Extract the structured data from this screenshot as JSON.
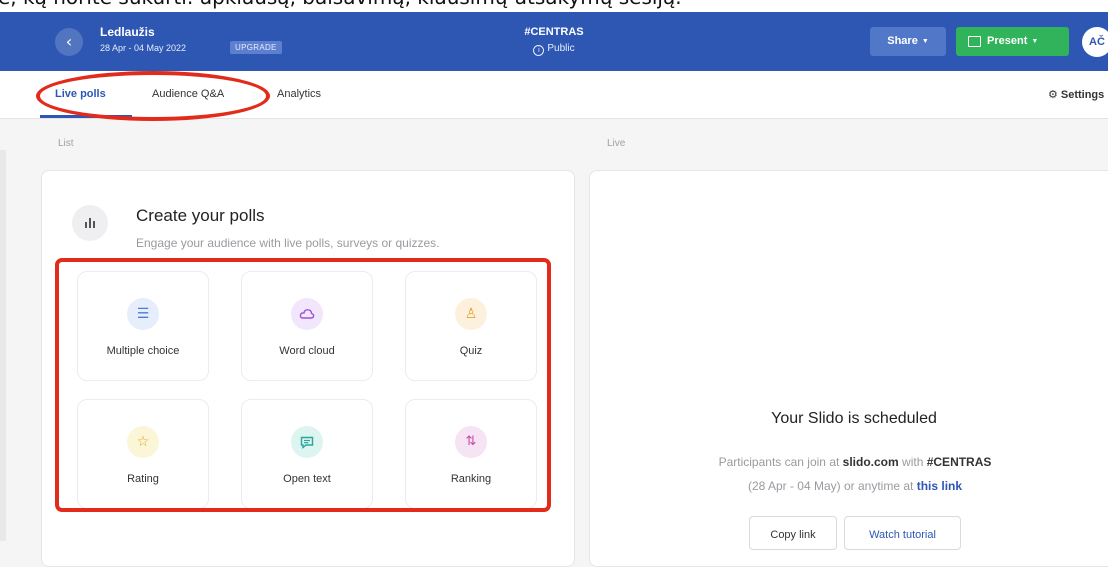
{
  "caption": "e, ką norite sukurti: apklausą, balsavimą, klausimų-atsakymų sesiją.",
  "header": {
    "event_title": "Ledlaužis",
    "event_dates": "28 Apr - 04 May 2022",
    "upgrade_label": "UPGRADE",
    "event_code": "#CENTRAS",
    "visibility": "Public",
    "share_label": "Share",
    "present_label": "Present",
    "avatar_initials": "AČ"
  },
  "tabs": {
    "live_polls": "Live polls",
    "audience_qa": "Audience Q&A",
    "analytics": "Analytics",
    "settings": "Settings"
  },
  "sections": {
    "list": "List",
    "live": "Live"
  },
  "create": {
    "title": "Create your polls",
    "subtitle": "Engage your audience with live polls, surveys or quizzes.",
    "poll_types": [
      {
        "label": "Multiple choice",
        "icon": "list-icon",
        "color": "#e6eefc"
      },
      {
        "label": "Word cloud",
        "icon": "cloud-icon",
        "color": "#f1e6fb"
      },
      {
        "label": "Quiz",
        "icon": "trophy-icon",
        "color": "#fdf1de"
      },
      {
        "label": "Rating",
        "icon": "star-icon",
        "color": "#fcf6d8"
      },
      {
        "label": "Open text",
        "icon": "chat-icon",
        "color": "#ddf4f1"
      },
      {
        "label": "Ranking",
        "icon": "sort-icon",
        "color": "#f6e3f3"
      }
    ]
  },
  "live": {
    "title": "Your Slido is scheduled",
    "text_1": "Participants can join at",
    "domain": "slido.com",
    "text_2": "with",
    "code": "#CENTRAS",
    "text_3": "(28 Apr - 04 May) or anytime at",
    "link_text": "this link",
    "copy_link": "Copy link",
    "watch_tutorial": "Watch tutorial"
  },
  "colors": {
    "brand_blue": "#2d57b3",
    "present_green": "#30b35a",
    "highlight_red": "#e22b1a"
  }
}
